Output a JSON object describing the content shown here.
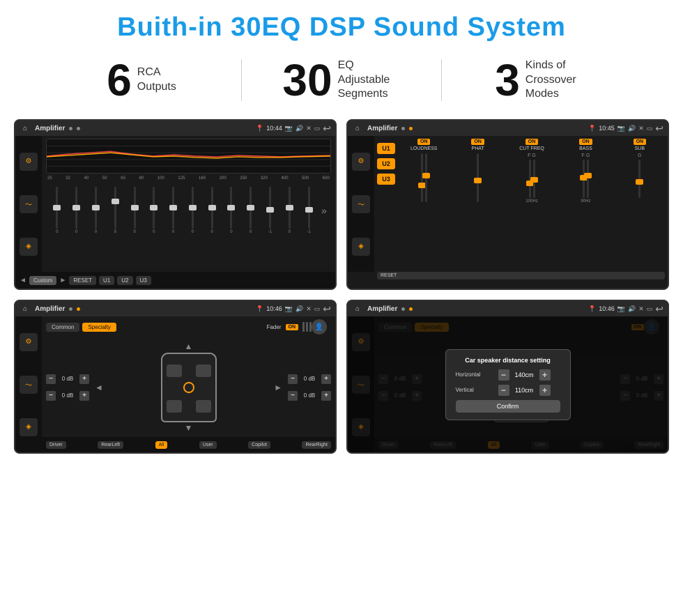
{
  "page": {
    "title": "Buith-in 30EQ DSP Sound System",
    "bg_color": "#ffffff"
  },
  "stats": [
    {
      "id": "rca",
      "number": "6",
      "label": "RCA\nOutputs"
    },
    {
      "id": "eq",
      "number": "30",
      "label": "EQ Adjustable\nSegments"
    },
    {
      "id": "crossover",
      "number": "3",
      "label": "Kinds of\nCrossover Modes"
    }
  ],
  "screens": [
    {
      "id": "eq-screen",
      "topbar": {
        "title": "Amplifier",
        "time": "10:44"
      },
      "freq_labels": [
        "25",
        "32",
        "40",
        "50",
        "63",
        "80",
        "100",
        "125",
        "160",
        "200",
        "250",
        "320",
        "400",
        "500",
        "630"
      ],
      "slider_values": [
        "0",
        "0",
        "0",
        "5",
        "0",
        "0",
        "0",
        "0",
        "0",
        "0",
        "0",
        "-1",
        "0",
        "-1"
      ],
      "bottom_buttons": [
        "Custom",
        "RESET",
        "U1",
        "U2",
        "U3"
      ]
    },
    {
      "id": "amp-screen",
      "topbar": {
        "title": "Amplifier",
        "time": "10:45"
      },
      "u_buttons": [
        "U1",
        "U2",
        "U3"
      ],
      "controls": [
        {
          "label": "LOUDNESS",
          "on": true
        },
        {
          "label": "PHAT",
          "on": true
        },
        {
          "label": "CUT FREQ",
          "on": true
        },
        {
          "label": "BASS",
          "on": true
        },
        {
          "label": "SUB",
          "on": true
        }
      ],
      "reset_label": "RESET"
    },
    {
      "id": "speaker-screen",
      "topbar": {
        "title": "Amplifier",
        "time": "10:46"
      },
      "tabs": [
        "Common",
        "Specialty"
      ],
      "fader_label": "Fader",
      "fader_on": true,
      "db_controls": [
        {
          "value": "0 dB",
          "side": "left",
          "row": 1
        },
        {
          "value": "0 dB",
          "side": "left",
          "row": 2
        },
        {
          "value": "0 dB",
          "side": "right",
          "row": 1
        },
        {
          "value": "0 dB",
          "side": "right",
          "row": 2
        }
      ],
      "bottom_buttons": [
        "Driver",
        "All",
        "User",
        "RearLeft",
        "Copilot",
        "RearRight"
      ]
    },
    {
      "id": "dialog-screen",
      "topbar": {
        "title": "Amplifier",
        "time": "10:46"
      },
      "dialog": {
        "title": "Car speaker distance setting",
        "rows": [
          {
            "label": "Horizontal",
            "value": "140cm"
          },
          {
            "label": "Vertical",
            "value": "110cm"
          }
        ],
        "confirm_label": "Confirm"
      },
      "tabs": [
        "Common",
        "Specialty"
      ],
      "bottom_buttons": [
        "Driver",
        "RearLeft",
        "All",
        "User",
        "Copilot",
        "RearRight"
      ]
    }
  ],
  "icons": {
    "home": "⌂",
    "back": "↩",
    "settings": "≡",
    "wave": "〜",
    "speaker": "♫",
    "volume": "🔊",
    "pin": "📍",
    "camera": "📷",
    "person": "👤",
    "arrow_left": "◄",
    "arrow_right": "►",
    "arrow_up": "▲",
    "arrow_down": "▼"
  }
}
